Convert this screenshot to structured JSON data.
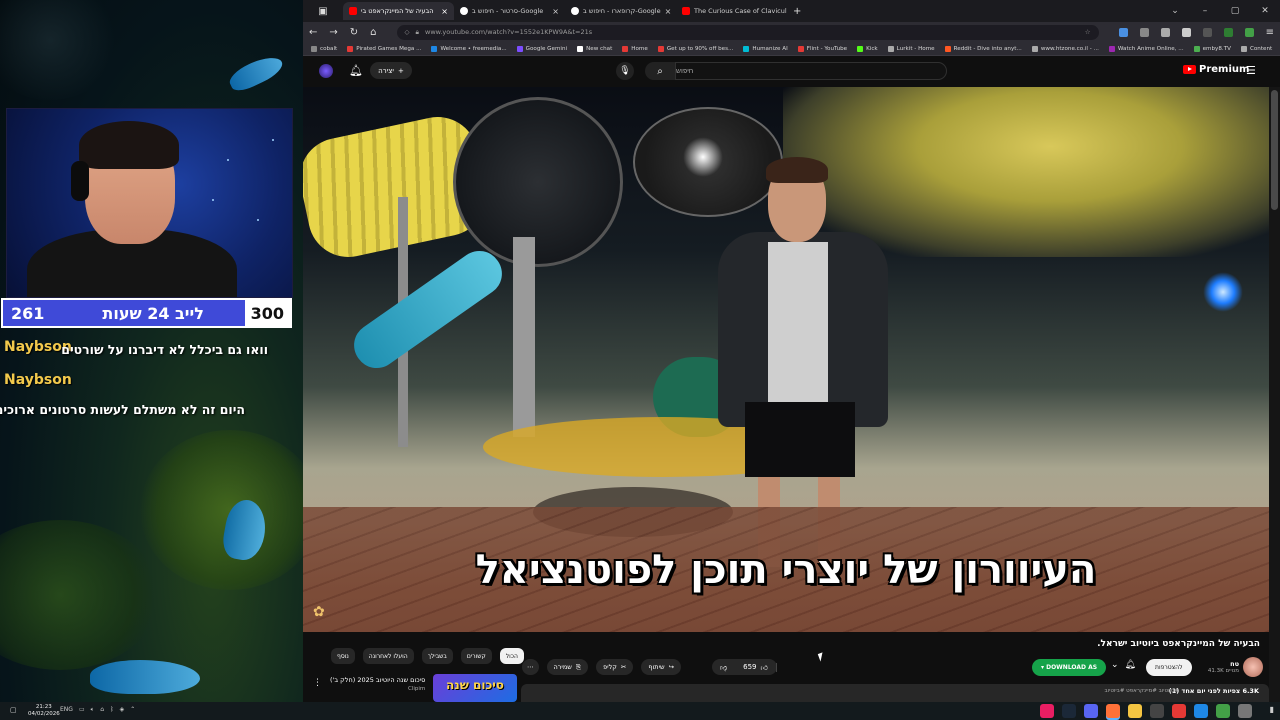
{
  "overlay": {
    "counter_left": "261",
    "counter_label": "לייב 24 שעות",
    "counter_right": "300",
    "chat": [
      {
        "user": "Naybson",
        "message": "וואו גם ביכלל לא דיברנו על שורטים"
      },
      {
        "user": "Naybson",
        "message": "היום זה לא משתלם לעשות סרטונים ארוכים"
      }
    ]
  },
  "browser": {
    "tabs": [
      {
        "title": "הבעיה של המיינקראפט בי",
        "color": "#ff0000"
      },
      {
        "title": "סרטור - חיפוש ב-Google",
        "color": "#ffffff"
      },
      {
        "title": "קרופארו - חיפוש ב-Google",
        "color": "#ffffff"
      },
      {
        "title": "The Curious Case of Claviculari",
        "color": "#ff0000"
      }
    ],
    "url": "www.youtube.com/watch?v=1552e1KPW9A&t=21s",
    "bookmarks": [
      {
        "label": "cobalt",
        "color": "#888888"
      },
      {
        "label": "Pirated Games Mega ...",
        "color": "#e53935"
      },
      {
        "label": "Welcome • freemedia...",
        "color": "#1e88e5"
      },
      {
        "label": "Google Gemini",
        "color": "#7c4dff"
      },
      {
        "label": "New chat",
        "color": "#ffffff"
      },
      {
        "label": "Home",
        "color": "#e53935"
      },
      {
        "label": "Get up to 90% off bes...",
        "color": "#e53935"
      },
      {
        "label": "Humanize AI",
        "color": "#00bcd4"
      },
      {
        "label": "Flint - YouTube",
        "color": "#e53935"
      },
      {
        "label": "Kick",
        "color": "#53fc18"
      },
      {
        "label": "Lurkit - Home",
        "color": "#aaaaaa"
      },
      {
        "label": "Reddit - Dive into anyt...",
        "color": "#ff5722"
      },
      {
        "label": "www.htzone.co.il - ...",
        "color": "#aaaaaa"
      },
      {
        "label": "Watch Anime Online, ...",
        "color": "#9c27b0"
      },
      {
        "label": "emby8.TV",
        "color": "#4caf50"
      },
      {
        "label": "Content",
        "color": "#aaaaaa"
      }
    ]
  },
  "youtube": {
    "create_label": "יצירה",
    "search_placeholder": "חיפוש",
    "logo_text": "Premium",
    "subtitle": "העיוורון של יוצרי תוכן לפוטנציאל",
    "video_title": "הבעיה של המיינקראפט ביוטיוב ישראל.",
    "chips": [
      "נוסף",
      "הועלו לאחרונה",
      "בשבילך",
      "קשורים",
      "הכול"
    ],
    "actions": {
      "save": "שמירה",
      "clip": "קליפ",
      "share": "שיתוף",
      "likes": "659"
    },
    "download_label": "▾ DOWNLOAD AS",
    "subscribe_label": "להצטרפות",
    "channel_name": "טח",
    "channel_subs": "41.3K מנויים",
    "views": "6.3K צפיות לפני יום אחד (1)",
    "tags": "#טיוטיוב #מיינקראפט #ביוטיוב",
    "rec_title": "סיכום שנה היוטיוב 2025 (חלק ב')",
    "rec_channel": "Clipim",
    "rec_thumb_text": "סיכום שנה"
  },
  "taskbar": {
    "time": "21:23",
    "date": "04/02/2026",
    "lang": "ENG"
  }
}
